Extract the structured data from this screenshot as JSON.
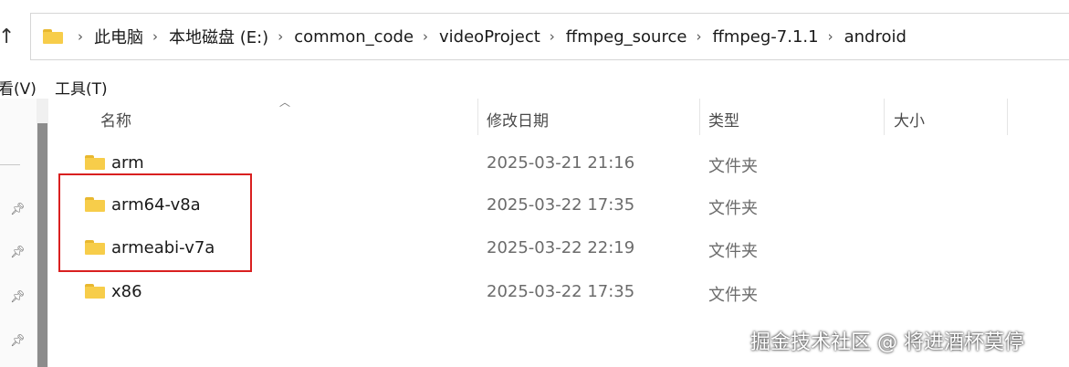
{
  "breadcrumb": [
    "此电脑",
    "本地磁盘 (E:)",
    "common_code",
    "videoProject",
    "ffmpeg_source",
    "ffmpeg-7.1.1",
    "android"
  ],
  "menu": {
    "view": "看(V)",
    "tools": "工具(T)"
  },
  "columns": {
    "name": "名称",
    "date": "修改日期",
    "type": "类型",
    "size": "大小"
  },
  "rows": [
    {
      "name": "arm",
      "date": "2025-03-21 21:16",
      "type": "文件夹"
    },
    {
      "name": "arm64-v8a",
      "date": "2025-03-22 17:35",
      "type": "文件夹"
    },
    {
      "name": "armeabi-v7a",
      "date": "2025-03-22 22:19",
      "type": "文件夹"
    },
    {
      "name": "x86",
      "date": "2025-03-22 17:35",
      "type": "文件夹"
    }
  ],
  "watermark": "掘金技术社区 @ 将进酒杯莫停",
  "colors": {
    "highlight": "#d92020",
    "folder": "#f7cd4a"
  }
}
